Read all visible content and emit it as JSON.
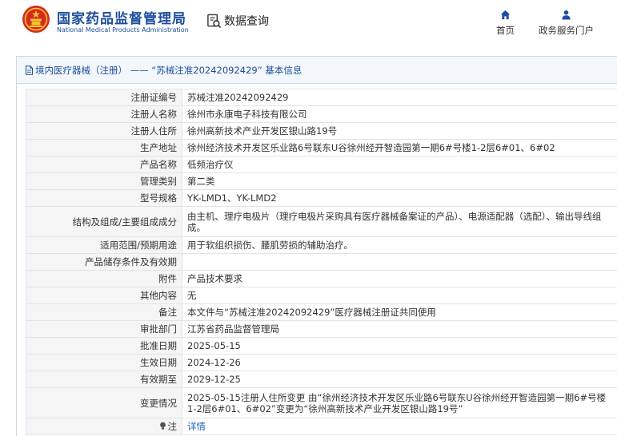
{
  "header": {
    "org_cn": "国家药品监督管理局",
    "org_en": "National Medical Products Administration",
    "query_label": "数据查询",
    "nav": {
      "home": "首页",
      "gov": "政务服务门户"
    }
  },
  "panel": {
    "title": "境内医疗器械（注册） ——  “苏械注准20242092429” 基本信息"
  },
  "rows": [
    {
      "label": "注册证编号",
      "value": "苏械注准20242092429"
    },
    {
      "label": "注册人名称",
      "value": "徐州市永康电子科技有限公司"
    },
    {
      "label": "注册人住所",
      "value": "徐州高新技术产业开发区银山路19号"
    },
    {
      "label": "生产地址",
      "value": "徐州经济技术开发区乐业路6号联东U谷徐州经开智造园第一期6#号楼1-2层6#01、6#02"
    },
    {
      "label": "产品名称",
      "value": "低频治疗仪"
    },
    {
      "label": "管理类别",
      "value": "第二类"
    },
    {
      "label": "型号规格",
      "value": "YK-LMD1、YK-LMD2"
    },
    {
      "label": "结构及组成/主要组成成分",
      "value": "由主机、理疗电极片（理疗电极片采购具有医疗器械备案证的产品）、电源适配器（选配）、输出导线组成。"
    },
    {
      "label": "适用范围/预期用途",
      "value": "用于软组织损伤、腰肌劳损的辅助治疗。"
    },
    {
      "label": "产品储存条件及有效期",
      "value": ""
    },
    {
      "label": "附件",
      "value": "产品技术要求"
    },
    {
      "label": "其他内容",
      "value": "无"
    },
    {
      "label": "备注",
      "value": "本文件与“苏械注准20242092429”医疗器械注册证共同使用"
    },
    {
      "label": "审批部门",
      "value": "江苏省药品监督管理局"
    },
    {
      "label": "批准日期",
      "value": "2025-05-15"
    },
    {
      "label": "生效日期",
      "value": "2024-12-26"
    },
    {
      "label": "有效期至",
      "value": "2029-12-25"
    },
    {
      "label": "变更情况",
      "value": "2025-05-15注册人住所变更 由“徐州经济技术开发区乐业路6号联东U谷徐州经开智造园第一期6#号楼1-2层6#01、6#02”变更为“徐州高新技术产业开发区银山路19号”"
    }
  ],
  "note": {
    "label": "注",
    "link": "详情"
  },
  "colors": {
    "brand": "#1d4f9c",
    "link": "#1d62c4",
    "emblem_red": "#d52b1e",
    "emblem_gold": "#f4c430"
  },
  "icons": {
    "logo": "national-emblem-icon",
    "query": "search-document-icon",
    "home": "home-icon",
    "gov": "user-icon",
    "panel": "document-icon",
    "note": "lightbulb-icon"
  }
}
